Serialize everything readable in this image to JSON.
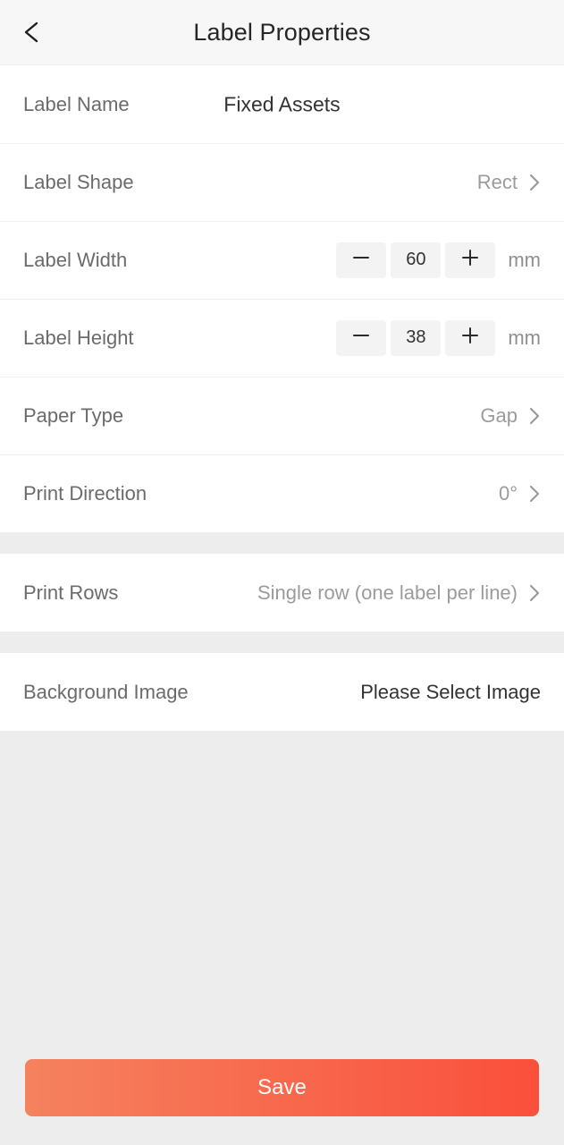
{
  "header": {
    "title": "Label Properties",
    "back_icon": "chevron-left-icon"
  },
  "form": {
    "groups": [
      {
        "rows": [
          {
            "label": "Label Name",
            "value": "Fixed Assets",
            "type": "text-center"
          },
          {
            "label": "Label Shape",
            "value": "Rect",
            "type": "nav"
          },
          {
            "label": "Label Width",
            "value": "60",
            "unit": "mm",
            "type": "stepper",
            "minus_icon": "minus-icon",
            "plus_icon": "plus-icon"
          },
          {
            "label": "Label Height",
            "value": "38",
            "unit": "mm",
            "type": "stepper",
            "minus_icon": "minus-icon",
            "plus_icon": "plus-icon"
          },
          {
            "label": "Paper Type",
            "value": "Gap",
            "type": "nav"
          },
          {
            "label": "Print Direction",
            "value": "0°",
            "type": "nav"
          }
        ]
      },
      {
        "rows": [
          {
            "label": "Print Rows",
            "value": "Single row (one label per line)",
            "type": "nav"
          }
        ]
      },
      {
        "rows": [
          {
            "label": "Background Image",
            "value": "Please Select Image",
            "type": "plain"
          }
        ]
      }
    ]
  },
  "footer": {
    "save_label": "Save"
  },
  "colors": {
    "accent_start": "#f5825f",
    "accent_end": "#fa4f3b",
    "page_background": "#ededed",
    "card_background": "#ffffff",
    "header_background": "#f7f7f7",
    "label_text": "#6b6b6b",
    "value_text": "#9b9b9b",
    "value_text_dark": "#333333",
    "chevron": "#9a9a9a",
    "stepper_box": "#f3f3f3"
  }
}
